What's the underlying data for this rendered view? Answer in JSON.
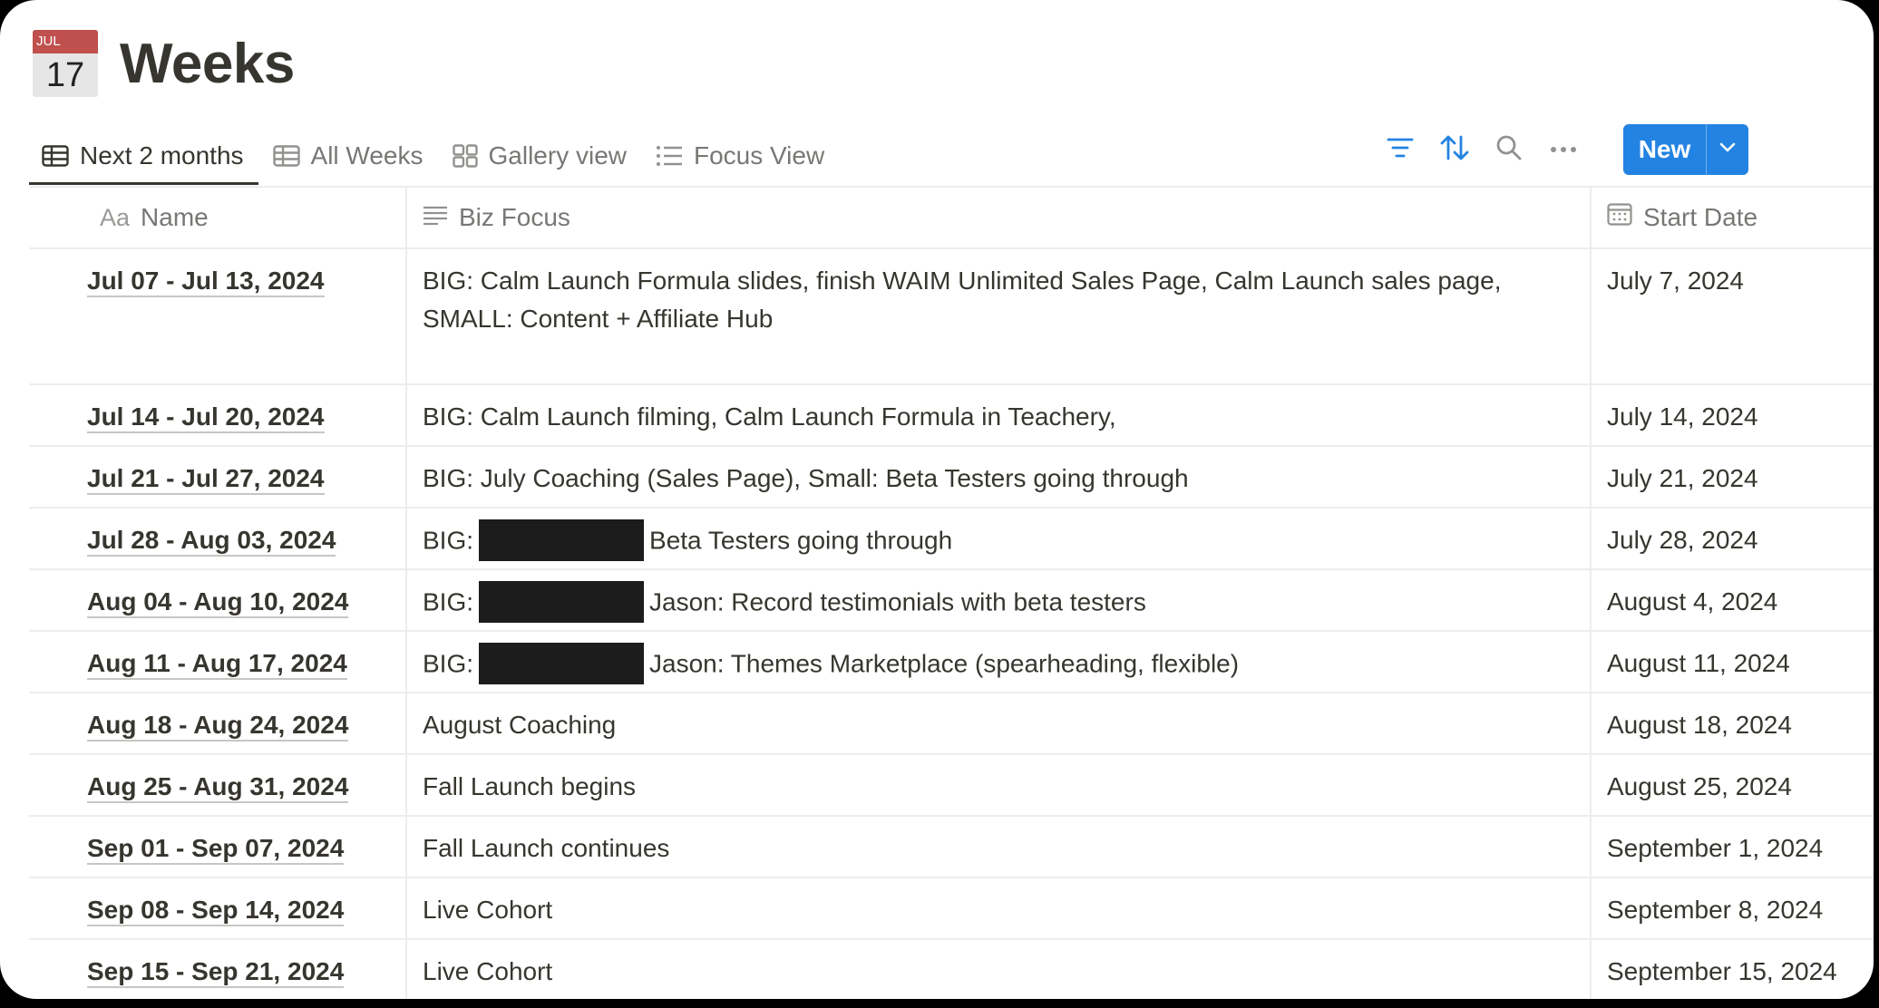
{
  "page": {
    "title": "Weeks",
    "icon": {
      "name": "calendar-icon",
      "month": "JUL",
      "day": "17"
    }
  },
  "tabs": [
    {
      "label": "Next 2 months",
      "icon": "table-icon",
      "active": true
    },
    {
      "label": "All Weeks",
      "icon": "table-icon",
      "active": false
    },
    {
      "label": "Gallery view",
      "icon": "gallery-icon",
      "active": false
    },
    {
      "label": "Focus View",
      "icon": "list-icon",
      "active": false
    }
  ],
  "toolbar": {
    "icons": [
      "filter-icon",
      "sort-icon",
      "search-icon",
      "more-icon"
    ],
    "new_label": "New",
    "accent": "#2383e2"
  },
  "table": {
    "columns": [
      {
        "label": "Name",
        "prefix": "Aa"
      },
      {
        "label": "Biz Focus",
        "icon": "text-lines-icon"
      },
      {
        "label": "Start Date",
        "icon": "calendar-icon"
      }
    ],
    "rows": [
      {
        "name": "Jul 07 - Jul 13, 2024",
        "focus_line1": "BIG: Calm Launch Formula slides, finish WAIM Unlimited Sales Page, Calm Launch sales page,",
        "focus_line2": "SMALL: Content + Affiliate Hub",
        "start": "July 7, 2024"
      },
      {
        "name": "Jul 14 - Jul 20, 2024",
        "focus": "BIG: Calm Launch filming, Calm Launch Formula in Teachery,",
        "start": "July 14, 2024"
      },
      {
        "name": "Jul 21 - Jul 27, 2024",
        "focus": "BIG: July Coaching (Sales Page), Small: Beta Testers going through",
        "start": "July 21, 2024"
      },
      {
        "name": "Jul 28 - Aug 03, 2024",
        "focus_prefix": "BIG:",
        "focus_rest": "Beta Testers going through",
        "start": "July 28, 2024"
      },
      {
        "name": "Aug 04 - Aug 10, 2024",
        "focus_prefix": "BIG:",
        "focus_rest": "Jason: Record testimonials with beta testers",
        "start": "August 4, 2024"
      },
      {
        "name": "Aug 11 - Aug 17, 2024",
        "focus_prefix": "BIG:",
        "focus_rest": "Jason: Themes Marketplace (spearheading, flexible)",
        "start": "August 11, 2024"
      },
      {
        "name": "Aug 18 - Aug 24, 2024",
        "focus": "August Coaching",
        "start": "August 18, 2024"
      },
      {
        "name": "Aug 25 - Aug 31, 2024",
        "focus": "Fall Launch begins",
        "start": "August 25, 2024"
      },
      {
        "name": "Sep 01 - Sep 07, 2024",
        "focus": "Fall Launch continues",
        "start": "September 1, 2024"
      },
      {
        "name": "Sep 08 - Sep 14, 2024",
        "focus": "Live Cohort",
        "start": "September 8, 2024"
      },
      {
        "name": "Sep 15 - Sep 21, 2024",
        "focus": "Live Cohort",
        "start": "September 15, 2024"
      }
    ]
  }
}
